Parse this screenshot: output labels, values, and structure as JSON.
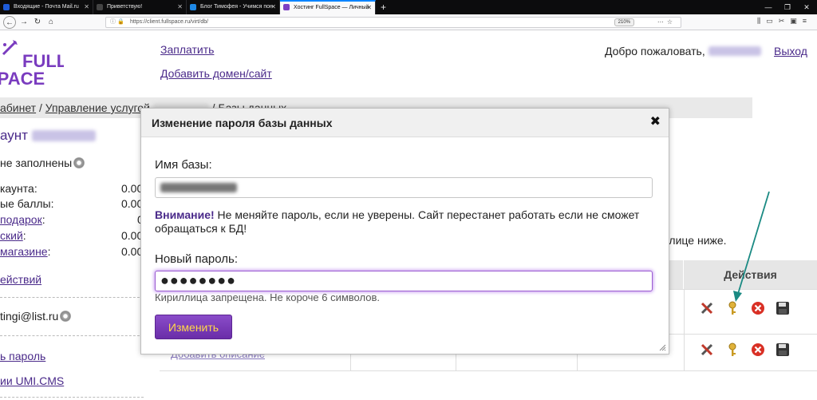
{
  "browser": {
    "tabs": [
      {
        "label": "Входящие - Почта Mail.ru",
        "color": "#1e5bd8"
      },
      {
        "label": "Приветствую!",
        "color": "#1a1a1a"
      },
      {
        "label": "Блог Тимофея - Учимся пон",
        "color": "#1e88e5"
      },
      {
        "label": "Хостинг FullSpace — Личный",
        "color": "#7b3fc4"
      }
    ],
    "url": "https://client.fullspace.ru/virt/db/",
    "zoom": "210%"
  },
  "header": {
    "logo_line1": "FULL",
    "logo_line2": "SPACE",
    "pay_link": "Заплатить",
    "add_domain_link": "Добавить домен/сайт",
    "welcome": "Добро пожаловать,",
    "logout": "Выход"
  },
  "breadcrumb": {
    "part1": "абинет",
    "sep1": " / ",
    "part2": "Управление услугой",
    "sep2": " / Базы данных"
  },
  "account": {
    "title": "аунт",
    "not_filled": "не заполнены",
    "rows": [
      {
        "label": "каунта:",
        "value": "0.00",
        "link": false
      },
      {
        "label": "ые баллы:",
        "value": "0.00",
        "link": false
      },
      {
        "label": "подарок",
        "suffix": ":",
        "value": "0",
        "link": true
      },
      {
        "label": "ский",
        "suffix": ":",
        "value": "0.00",
        "link": true
      },
      {
        "label": "магазине",
        "suffix": ":",
        "value": "0.00",
        "link": true
      }
    ],
    "actions_link": "ействий",
    "email": "tingi@list.ru",
    "password_link": "ь пароль",
    "umi_link": "ии UMI.CMS"
  },
  "main": {
    "table_note": "таблице ниже.",
    "actions_header": "Действия",
    "add_description": "Добавить описание"
  },
  "modal": {
    "title": "Изменение пароля базы данных",
    "close": "✖",
    "db_name_label": "Имя базы:",
    "warning_bold": "Внимание!",
    "warning_text": " Не меняйте пароль, если не уверены. Сайт перестанет работать если не сможет обращаться к БД!",
    "new_password_label": "Новый пароль:",
    "new_password_value": "●●●●●●●●",
    "hint": "Кириллица запрещена. Не короче 6 символов.",
    "submit": "Изменить"
  },
  "colors": {
    "accent": "#4a2a8a",
    "button": "#7a3cbf",
    "button_text": "#ffd84a",
    "arrow": "#1a8a83"
  }
}
